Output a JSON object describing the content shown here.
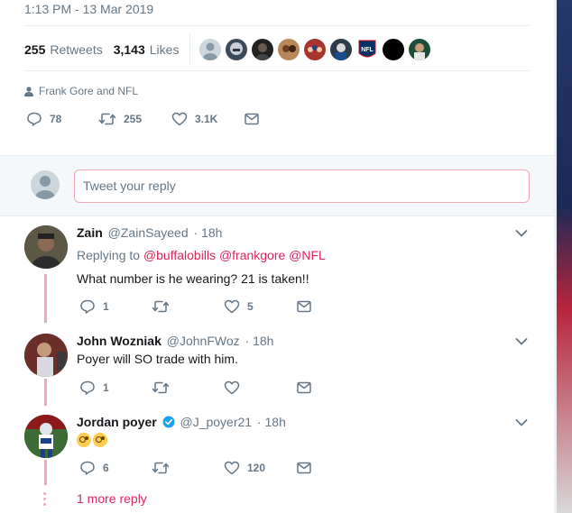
{
  "tweet": {
    "timestamp": "1:13 PM - 13 Mar 2019",
    "retweets_count": "255",
    "retweets_label": "Retweets",
    "likes_count": "3,143",
    "likes_label": "Likes",
    "liker_avatars": [
      "avatar-gray",
      "avatar-helmet",
      "avatar-dark",
      "avatar-couple",
      "avatar-group",
      "avatar-player",
      "avatar-nfl",
      "avatar-black",
      "avatar-green"
    ],
    "nfl_logo_text": "NFL",
    "context": "Frank Gore and NFL",
    "actions": {
      "replies": "78",
      "retweets": "255",
      "likes": "3.1K"
    }
  },
  "reply_box": {
    "placeholder": "Tweet your reply"
  },
  "replies": [
    {
      "name": "Zain",
      "handle": "@ZainSayeed",
      "time": "· 18h",
      "replying_prefix": "Replying to",
      "mentions": "@buffalobills @frankgore @NFL",
      "text": "What number is he wearing? 21 is taken!!",
      "reply_count": "1",
      "retweet_count": "",
      "like_count": "5"
    },
    {
      "name": "John Wozniak",
      "handle": "@JohnFWoz",
      "time": "· 18h",
      "text": "Poyer will SO trade with him.",
      "reply_count": "1",
      "retweet_count": "",
      "like_count": ""
    },
    {
      "name": "Jordan poyer",
      "handle": "@J_poyer21",
      "time": "· 18h",
      "text": "",
      "emoji": [
        "monocle-face-emoji",
        "monocle-face-emoji"
      ],
      "reply_count": "6",
      "retweet_count": "",
      "like_count": "120"
    }
  ],
  "more_replies": "1 more reply",
  "colors": {
    "accent": "#e0245e",
    "secondary_text": "#657786",
    "thread_line": "#f3a6b4",
    "verified": "#1da1f2"
  }
}
